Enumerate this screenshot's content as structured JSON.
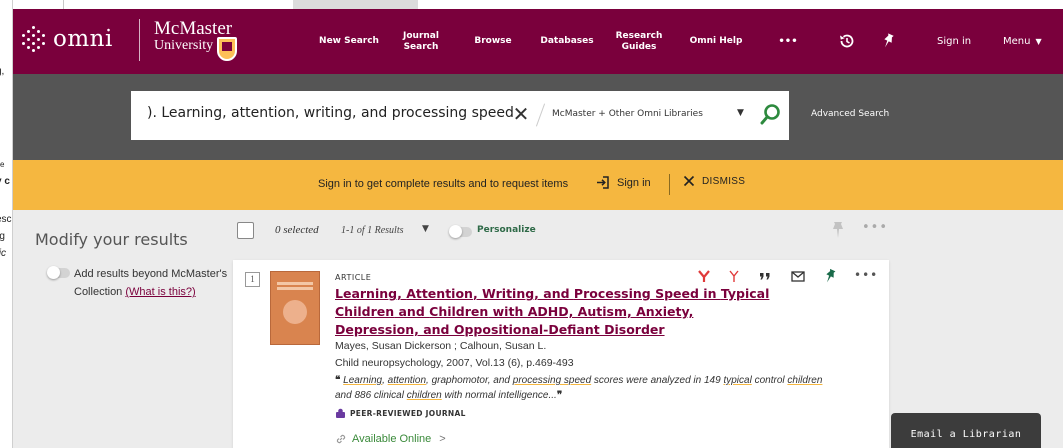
{
  "left_window": {
    "fragments": [
      "g,",
      "ve",
      "y c",
      "esc",
      "rg",
      "tic"
    ]
  },
  "header": {
    "logo_text": "omni",
    "university_line1": "McMaster",
    "university_line2": "University",
    "nav": [
      {
        "label": "New Search"
      },
      {
        "label": "Journal\nSearch"
      },
      {
        "label": "Browse"
      },
      {
        "label": "Databases"
      },
      {
        "label": "Research\nGuides"
      },
      {
        "label": "Omni Help"
      }
    ],
    "more_label": "•••",
    "sign_in": "Sign in",
    "menu": "Menu"
  },
  "search": {
    "query": "). Learning, attention, writing, and processing speed",
    "clear_symbol": "✕",
    "scope": "McMaster + Other Omni Libraries",
    "advanced": "Advanced Search"
  },
  "banner": {
    "message": "Sign in to get complete results and to request items",
    "sign_in": "Sign in",
    "dismiss": "DISMISS"
  },
  "facets": {
    "heading": "Modify your results",
    "toggle_text": "Add results beyond McMaster's Collection",
    "toggle_link": "(What is this?)"
  },
  "toolbar": {
    "selected": "0 selected",
    "results": "1-1 of 1 Results",
    "personalize": "Personalize",
    "more": "•••"
  },
  "result": {
    "number": "1",
    "type": "ARTICLE",
    "title_parts": [
      "Learning",
      ", ",
      "Attention",
      ", ",
      "Writing",
      ", and ",
      "Processing Speed",
      " in ",
      "Typical",
      " ",
      "Children",
      " and ",
      "Children",
      " with ADHD, Autism, Anxiety, Depression, and Oppositional-Defiant Disorder"
    ],
    "authors": "Mayes, Susan Dickerson ; Calhoun, Susan L.",
    "source": "Child neuropsychology, 2007, Vol.13 (6), p.469-493",
    "snippet_parts": [
      "Learning",
      ", ",
      "attention",
      ", graphomotor, and ",
      "processing speed",
      " scores were analyzed in 149 ",
      "typical",
      " control ",
      "children",
      " and 886 clinical ",
      "children",
      " with normal intelligence..."
    ],
    "peer_reviewed": "PEER-REVIEWED JOURNAL",
    "availability": "Available Online",
    "availability_arrow": ">",
    "more": "•••"
  },
  "email_librarian": "Email a Librarian",
  "colors": {
    "brand": "#7a003c",
    "gold": "#f5b740",
    "search_band": "#555555",
    "available": "#3a8a3a"
  }
}
